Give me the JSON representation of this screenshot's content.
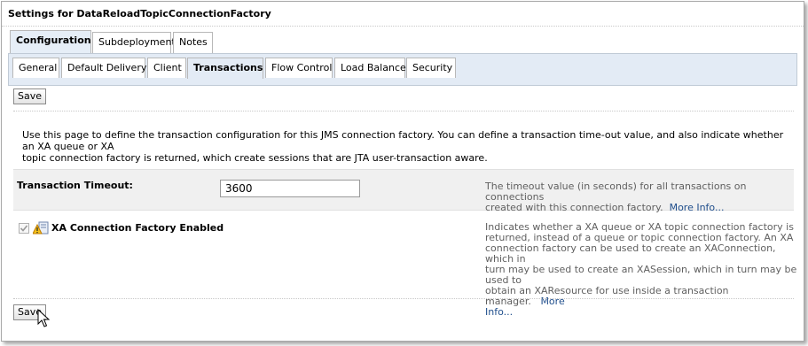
{
  "title": "Settings for DataReloadTopicConnectionFactory",
  "top_tabs": [
    {
      "label": "Configuration",
      "active": true
    },
    {
      "label": "Subdeployment",
      "active": false
    },
    {
      "label": "Notes",
      "active": false
    }
  ],
  "sub_tabs": [
    {
      "label": "General",
      "active": false
    },
    {
      "label": "Default Delivery",
      "active": false
    },
    {
      "label": "Client",
      "active": false
    },
    {
      "label": "Transactions",
      "active": true
    },
    {
      "label": "Flow Control",
      "active": false
    },
    {
      "label": "Load Balance",
      "active": false
    },
    {
      "label": "Security",
      "active": false
    }
  ],
  "save_label": "Save",
  "description_line1": "Use this page to define the transaction configuration for this JMS connection factory. You can define a transaction time-out value, and also indicate whether an XA queue or XA",
  "description_line2": "topic connection factory is returned, which create sessions that are JTA user-transaction aware.",
  "timeout": {
    "label": "Transaction Timeout:",
    "value": "3600",
    "help_line1": "The timeout value (in seconds) for all transactions on connections",
    "help_line2": "created with this connection factory.",
    "more_info": "More Info..."
  },
  "xa": {
    "label": "XA Connection Factory Enabled",
    "checked": true,
    "help_lines": [
      "Indicates whether a XA queue or XA topic connection factory is",
      "returned, instead of a queue or topic connection factory. An XA",
      "connection factory can be used to create an XAConnection, which in",
      "turn may be used to create an XASession, which in turn may be used to",
      "obtain an XAResource for use inside a transaction manager."
    ],
    "more_info_1": "More",
    "more_info_2": "Info..."
  }
}
